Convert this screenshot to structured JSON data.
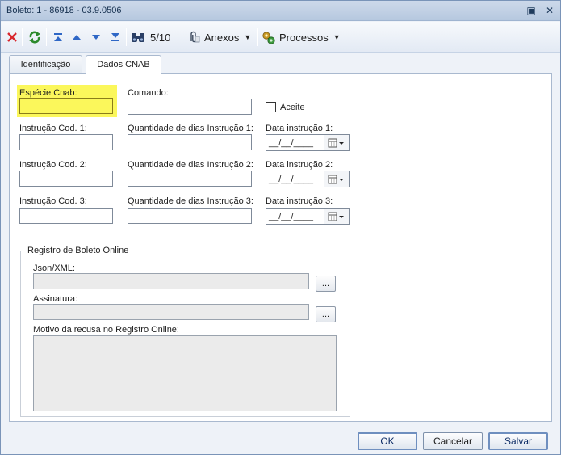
{
  "window": {
    "title": "Boleto: 1 - 86918 - 03.9.0506"
  },
  "title_buttons": {
    "restore_glyph": "▣",
    "close_glyph": "✕"
  },
  "toolbar": {
    "record_counter": "5/10",
    "attachments_label": "Anexos",
    "processes_label": "Processos",
    "dropdown_glyph": "▼"
  },
  "tabs": [
    {
      "label": "Identificação"
    },
    {
      "label": "Dados CNAB"
    }
  ],
  "form": {
    "especie_label": "Espécie Cnab:",
    "especie_value": "",
    "comando_label": "Comando:",
    "comando_value": "",
    "aceite_label": "Aceite",
    "instr1_label": "Instrução Cod. 1:",
    "qty1_label": "Quantidade de dias Instrução 1:",
    "date1_label": "Data instrução 1:",
    "instr2_label": "Instrução Cod. 2:",
    "qty2_label": "Quantidade de dias Instrução 2:",
    "date2_label": "Data instrução 2:",
    "instr3_label": "Instrução Cod. 3:",
    "qty3_label": "Quantidade de dias Instrução 3:",
    "date3_label": "Data instrução 3:",
    "date_mask": "__/__/____"
  },
  "online_registry": {
    "group_title": "Registro de Boleto Online",
    "json_label": "Json/XML:",
    "signature_label": "Assinatura:",
    "reason_label": "Motivo da recusa no Registro Online:",
    "browse_label": "..."
  },
  "footer": {
    "ok_label": "OK",
    "cancel_label": "Cancelar",
    "save_label": "Salvar"
  },
  "colors": {
    "highlight": "#fbf75b",
    "delete_red": "#d8262c",
    "refresh_green": "#2c8a2c",
    "nav_blue": "#2f67c6"
  }
}
